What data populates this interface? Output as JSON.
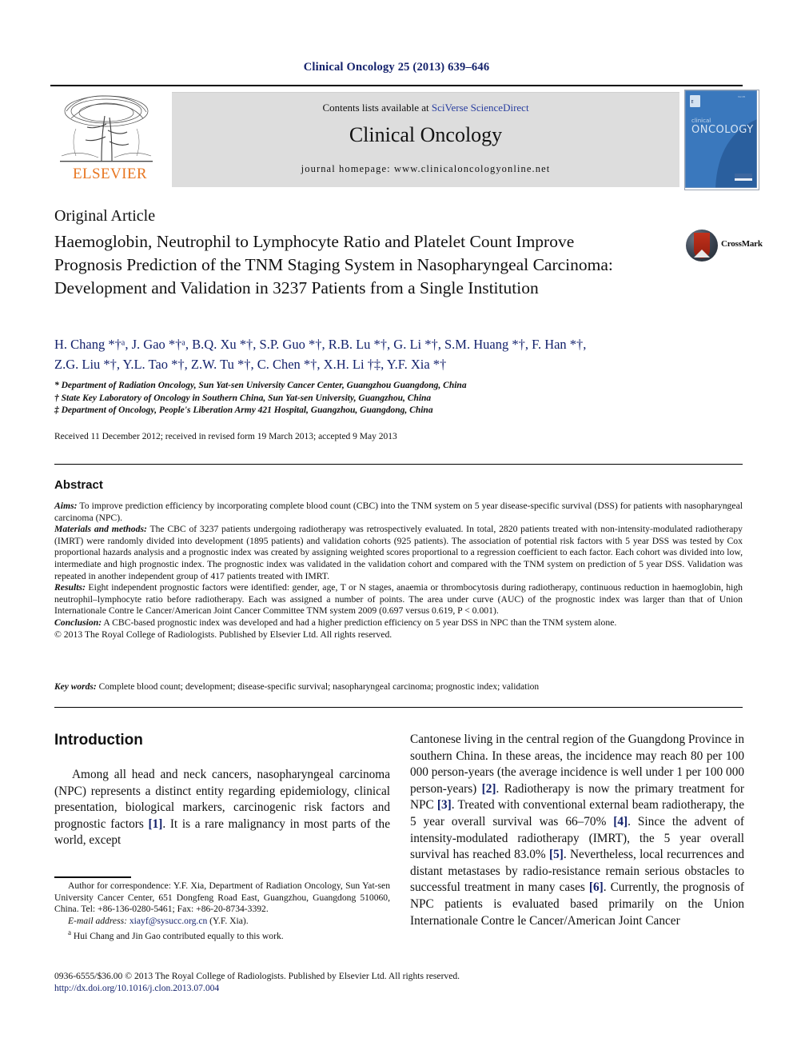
{
  "running_head": "Clinical Oncology 25 (2013) 639–646",
  "masthead": {
    "contents_prefix": "Contents lists available at ",
    "contents_link": "SciVerse ScienceDirect",
    "journal_name": "Clinical Oncology",
    "homepage": "journal homepage: www.clinicaloncologyonline.net",
    "publisher_logo_text": "ELSEVIER",
    "cover_title_small": "clinical",
    "cover_title_large": "ONCOLOGY"
  },
  "article": {
    "kind": "Original Article",
    "title": "Haemoglobin, Neutrophil to Lymphocyte Ratio and Platelet Count Improve Prognosis Prediction of the TNM Staging System in Nasopharyngeal Carcinoma: Development and Validation in 3237 Patients from a Single Institution",
    "crossmark_label": "CrossMark",
    "authors_line1": "H. Chang *†ᵃ, J. Gao *†ᵃ, B.Q. Xu *†, S.P. Guo *†, R.B. Lu *†, G. Li *†, S.M. Huang *†, F. Han *†,",
    "authors_line2": "Z.G. Liu *†, Y.L. Tao *†, Z.W. Tu *†, C. Chen *†, X.H. Li †‡, Y.F. Xia *†",
    "affiliations": [
      "* Department of Radiation Oncology, Sun Yat-sen University Cancer Center, Guangzhou Guangdong, China",
      "† State Key Laboratory of Oncology in Southern China, Sun Yat-sen University, Guangzhou, China",
      "‡ Department of Oncology, People's Liberation Army 421 Hospital, Guangzhou, Guangdong, China"
    ],
    "history": "Received 11 December 2012; received in revised form 19 March 2013; accepted 9 May 2013"
  },
  "abstract": {
    "heading": "Abstract",
    "sections": [
      {
        "label": "Aims:",
        "text": " To improve prediction efficiency by incorporating complete blood count (CBC) into the TNM system on 5 year disease-specific survival (DSS) for patients with nasopharyngeal carcinoma (NPC)."
      },
      {
        "label": "Materials and methods:",
        "text": " The CBC of 3237 patients undergoing radiotherapy was retrospectively evaluated. In total, 2820 patients treated with non-intensity-modulated radiotherapy (IMRT) were randomly divided into development (1895 patients) and validation cohorts (925 patients). The association of potential risk factors with 5 year DSS was tested by Cox proportional hazards analysis and a prognostic index was created by assigning weighted scores proportional to a regression coefficient to each factor. Each cohort was divided into low, intermediate and high prognostic index. The prognostic index was validated in the validation cohort and compared with the TNM system on prediction of 5 year DSS. Validation was repeated in another independent group of 417 patients treated with IMRT."
      },
      {
        "label": "Results:",
        "text": " Eight independent prognostic factors were identified: gender, age, T or N stages, anaemia or thrombocytosis during radiotherapy, continuous reduction in haemoglobin, high neutrophil–lymphocyte ratio before radiotherapy. Each was assigned a number of points. The area under curve (AUC) of the prognostic index was larger than that of Union Internationale Contre le Cancer/American Joint Cancer Committee TNM system 2009 (0.697 versus 0.619, P < 0.001)."
      },
      {
        "label": "Conclusion:",
        "text": " A CBC-based prognostic index was developed and had a higher prediction efficiency on 5 year DSS in NPC than the TNM system alone."
      }
    ],
    "copyright": "© 2013 The Royal College of Radiologists. Published by Elsevier Ltd. All rights reserved.",
    "keywords_label": "Key words:",
    "keywords_text": " Complete blood count; development; disease-specific survival; nasopharyngeal carcinoma; prognostic index; validation"
  },
  "introduction": {
    "heading": "Introduction",
    "left_paragraph_pre": "Among all head and neck cancers, nasopharyngeal carcinoma (NPC) represents a distinct entity regarding epidemiology, clinical presentation, biological markers, carcinogenic risk factors and prognostic factors ",
    "left_ref_1": "[1]",
    "left_paragraph_post": ". It is a rare malignancy in most parts of the world, except",
    "right_pre_2": "Cantonese living in the central region of the Guangdong Province in southern China. In these areas, the incidence may reach 80 per 100 000 person-years (the average incidence is well under 1 per 100 000 person-years) ",
    "right_ref_2": "[2]",
    "right_mid_3": ". Radiotherapy is now the primary treatment for NPC ",
    "right_ref_3": "[3]",
    "right_mid_4": ". Treated with conventional external beam radiotherapy, the 5 year overall survival was 66–70% ",
    "right_ref_4": "[4]",
    "right_mid_5": ". Since the advent of intensity-modulated radiotherapy (IMRT), the 5 year overall survival has reached 83.0% ",
    "right_ref_5": "[5]",
    "right_mid_6": ". Nevertheless, local recurrences and distant metastases by radio-resistance remain serious obstacles to successful treatment in many cases ",
    "right_ref_6": "[6]",
    "right_post": ". Currently, the prognosis of NPC patients is evaluated based primarily on the Union Internationale Contre le Cancer/American Joint Cancer"
  },
  "footnote": {
    "correspondence": "Author for correspondence: Y.F. Xia, Department of Radiation Oncology, Sun Yat-sen University Cancer Center, 651 Dongfeng Road East, Guangzhou, Guangdong 510060, China. Tel: +86-136-0280-5461; Fax: +86-20-8734-3392.",
    "email_label": "E-mail address:",
    "email": "xiayf@sysucc.org.cn",
    "email_suffix": " (Y.F. Xia).",
    "equal_contrib_marker": "a",
    "equal_contrib": " Hui Chang and Jin Gao contributed equally to this work."
  },
  "imprint": {
    "line1": "0936-6555/$36.00 © 2013 The Royal College of Radiologists. Published by Elsevier Ltd. All rights reserved.",
    "doi": "http://dx.doi.org/10.1016/j.clon.2013.07.004"
  },
  "colors": {
    "link_blue": "#13216b",
    "elsevier_orange": "#e87722",
    "cover_blue": "#2f6fb5",
    "masthead_gray": "#dddddd"
  }
}
